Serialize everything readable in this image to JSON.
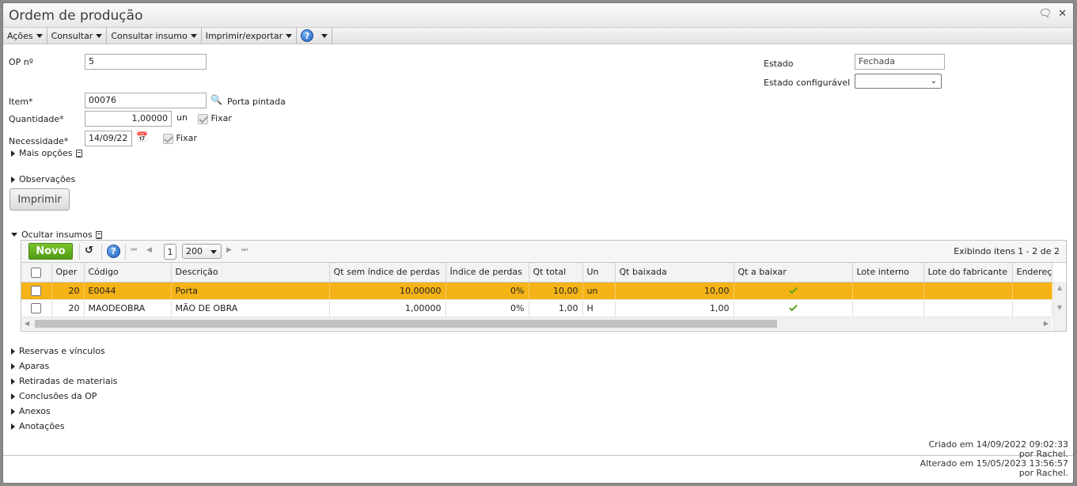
{
  "window": {
    "title": "Ordem de produção"
  },
  "menu": {
    "acoes": "Ações",
    "consultar": "Consultar",
    "consultar_insumo": "Consultar insumo",
    "imprimir_exportar": "Imprimir/exportar",
    "help": "?"
  },
  "form": {
    "op_label": "OP nº",
    "op_value": "5",
    "estado_label": "Estado",
    "estado_value": "Fechada",
    "estado_config_label": "Estado configurável",
    "estado_config_value": "",
    "item_label": "Item*",
    "item_value": "00076",
    "item_desc": "Porta pintada",
    "quantidade_label": "Quantidade*",
    "quantidade_value": "1,00000",
    "quantidade_unit": "un",
    "fixar_label": "Fixar",
    "necessidade_label": "Necessidade*",
    "necessidade_value": "14/09/22",
    "fixar2_label": "Fixar"
  },
  "sections": {
    "mais_opcoes": "Mais opções",
    "observacoes": "Observações",
    "imprimir_button": "Imprimir",
    "ocultar_insumos": "Ocultar insumos"
  },
  "grid": {
    "novo_button": "Novo",
    "page": "1",
    "page_size": "200",
    "showing": "Exibindo itens 1 - 2 de 2",
    "columns": [
      "Oper",
      "Código",
      "Descrição",
      "Qt sem índice de perdas",
      "Índice de perdas",
      "Qt total",
      "Un",
      "Qt baixada",
      "Qt a baixar",
      "Lote interno",
      "Lote do fabricante",
      "Endereço"
    ],
    "rows": [
      {
        "oper": "20",
        "codigo": "E0044",
        "descricao": "Porta",
        "qt_sem": "10,00000",
        "indice": "0%",
        "qt_total": "10,00",
        "un": "un",
        "qt_baixada": "10,00"
      },
      {
        "oper": "20",
        "codigo": "MAODEOBRA",
        "descricao": "MÃO DE OBRA",
        "qt_sem": "1,00000",
        "indice": "0%",
        "qt_total": "1,00",
        "un": "H",
        "qt_baixada": "1,00"
      }
    ]
  },
  "lower_sections": [
    "Reservas e vínculos",
    "Aparas",
    "Retiradas de materiais",
    "Conclusões da OP",
    "Anexos",
    "Anotações"
  ],
  "footer": {
    "created": "Criado em 14/09/2022 09:02:33",
    "created_by": "por Rachel.",
    "changed": "Alterado em 15/05/2023 13:56:57",
    "changed_by": "por Rachel."
  },
  "colors": {
    "selected_row": "#f5b317",
    "novo_green": "#5aa81a"
  }
}
